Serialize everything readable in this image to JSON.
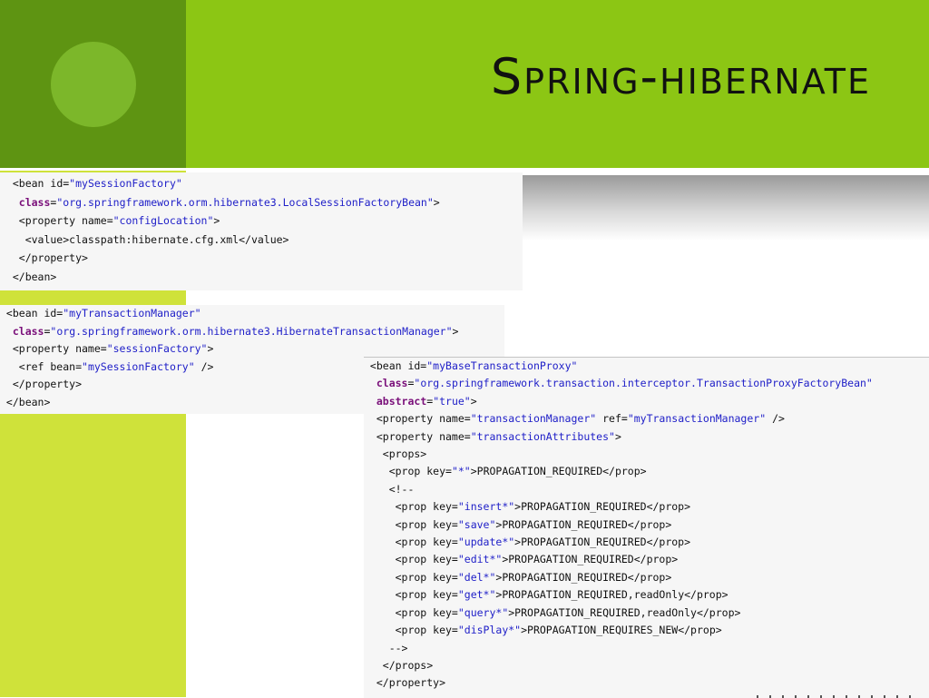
{
  "slide": {
    "title": "Spring-hibernate",
    "colors": {
      "header": "#8cc614",
      "header_dark": "#5e9412",
      "side_band": "#cfe23a",
      "circle": "#7cb72a"
    }
  },
  "code_blocks": [
    {
      "name": "session-factory-bean",
      "lines": [
        [
          [
            "  ",
            "plain"
          ],
          [
            "<bean id=",
            "plain"
          ],
          [
            "\"mySessionFactory\"",
            "str"
          ]
        ],
        [
          [
            "   ",
            "plain"
          ],
          [
            "class",
            "attr"
          ],
          [
            "=",
            "plain"
          ],
          [
            "\"org.springframework.orm.hibernate3.LocalSessionFactoryBean\"",
            "str"
          ],
          [
            ">",
            "plain"
          ]
        ],
        [
          [
            "   <property name=",
            "plain"
          ],
          [
            "\"configLocation\"",
            "str"
          ],
          [
            ">",
            "plain"
          ]
        ],
        [
          [
            "    <value>classpath:hibernate.cfg.xml</value>",
            "plain"
          ]
        ],
        [
          [
            "   </property>",
            "plain"
          ]
        ],
        [
          [
            "  </bean>",
            "plain"
          ]
        ]
      ]
    },
    {
      "name": "transaction-manager-bean",
      "lines": [
        [
          [
            " <bean id=",
            "plain"
          ],
          [
            "\"myTransactionManager\"",
            "str"
          ]
        ],
        [
          [
            "  ",
            "plain"
          ],
          [
            "class",
            "attr"
          ],
          [
            "=",
            "plain"
          ],
          [
            "\"org.springframework.orm.hibernate3.HibernateTransactionManager\"",
            "str"
          ],
          [
            ">",
            "plain"
          ]
        ],
        [
          [
            "  <property name=",
            "plain"
          ],
          [
            "\"sessionFactory\"",
            "str"
          ],
          [
            ">",
            "plain"
          ]
        ],
        [
          [
            "   <ref bean=",
            "plain"
          ],
          [
            "\"mySessionFactory\"",
            "str"
          ],
          [
            " />",
            "plain"
          ]
        ],
        [
          [
            "  </property>",
            "plain"
          ]
        ],
        [
          [
            " </bean>",
            "plain"
          ]
        ]
      ]
    },
    {
      "name": "base-transaction-proxy-bean",
      "lines": [
        [
          [
            " <bean id=",
            "plain"
          ],
          [
            "\"myBaseTransactionProxy\"",
            "str"
          ]
        ],
        [
          [
            "  ",
            "plain"
          ],
          [
            "class",
            "attr"
          ],
          [
            "=",
            "plain"
          ],
          [
            "\"org.springframework.transaction.interceptor.TransactionProxyFactoryBean\"",
            "str"
          ]
        ],
        [
          [
            "  ",
            "plain"
          ],
          [
            "abstract",
            "attr"
          ],
          [
            "=",
            "plain"
          ],
          [
            "\"true\"",
            "str"
          ],
          [
            ">",
            "plain"
          ]
        ],
        [
          [
            "  <property name=",
            "plain"
          ],
          [
            "\"transactionManager\"",
            "str"
          ],
          [
            " ref=",
            "plain"
          ],
          [
            "\"myTransactionManager\"",
            "str"
          ],
          [
            " />",
            "plain"
          ]
        ],
        [
          [
            "  <property name=",
            "plain"
          ],
          [
            "\"transactionAttributes\"",
            "str"
          ],
          [
            ">",
            "plain"
          ]
        ],
        [
          [
            "   <props>",
            "plain"
          ]
        ],
        [
          [
            "    <prop key=",
            "plain"
          ],
          [
            "\"*\"",
            "str"
          ],
          [
            ">PROPAGATION_REQUIRED</prop>",
            "plain"
          ]
        ],
        [
          [
            "    <!--",
            "plain"
          ]
        ],
        [
          [
            "     <prop key=",
            "plain"
          ],
          [
            "\"insert*\"",
            "str"
          ],
          [
            ">PROPAGATION_REQUIRED</prop>",
            "plain"
          ]
        ],
        [
          [
            "     <prop key=",
            "plain"
          ],
          [
            "\"save\"",
            "str"
          ],
          [
            ">PROPAGATION_REQUIRED</prop>",
            "plain"
          ]
        ],
        [
          [
            "     <prop key=",
            "plain"
          ],
          [
            "\"update*\"",
            "str"
          ],
          [
            ">PROPAGATION_REQUIRED</prop>",
            "plain"
          ]
        ],
        [
          [
            "     <prop key=",
            "plain"
          ],
          [
            "\"edit*\"",
            "str"
          ],
          [
            ">PROPAGATION_REQUIRED</prop>",
            "plain"
          ]
        ],
        [
          [
            "     <prop key=",
            "plain"
          ],
          [
            "\"del*\"",
            "str"
          ],
          [
            ">PROPAGATION_REQUIRED</prop>",
            "plain"
          ]
        ],
        [
          [
            "     <prop key=",
            "plain"
          ],
          [
            "\"get*\"",
            "str"
          ],
          [
            ">PROPAGATION_REQUIRED,readOnly</prop>",
            "plain"
          ]
        ],
        [
          [
            "     <prop key=",
            "plain"
          ],
          [
            "\"query*\"",
            "str"
          ],
          [
            ">PROPAGATION_REQUIRED,readOnly</prop>",
            "plain"
          ]
        ],
        [
          [
            "     <prop key=",
            "plain"
          ],
          [
            "\"disPlay*\"",
            "str"
          ],
          [
            ">PROPAGATION_REQUIRES_NEW</prop>",
            "plain"
          ]
        ],
        [
          [
            "    -->",
            "plain"
          ]
        ],
        [
          [
            "   </props>",
            "plain"
          ]
        ],
        [
          [
            "  </property>",
            "plain"
          ]
        ]
      ]
    }
  ]
}
